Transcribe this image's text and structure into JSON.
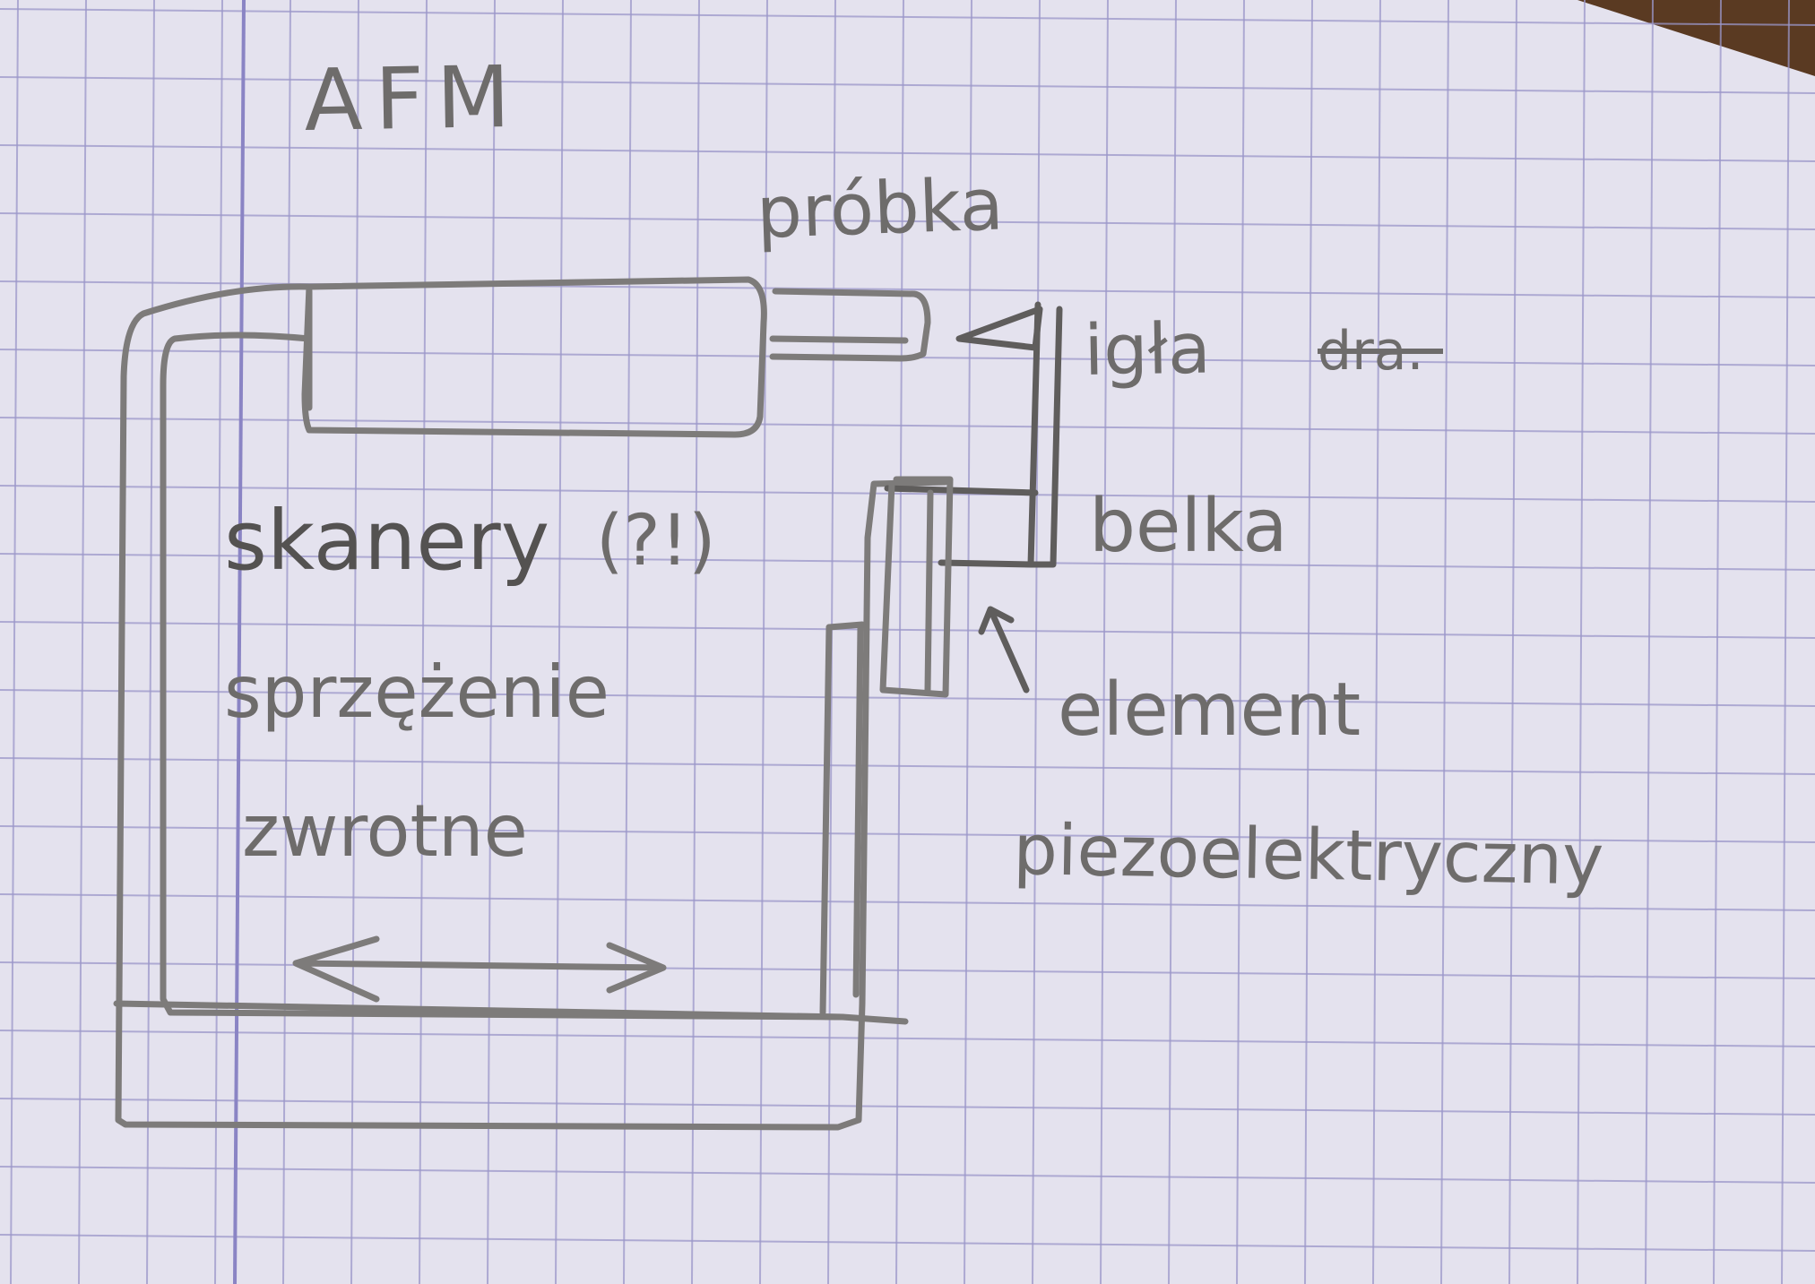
{
  "labels": {
    "title": "AFM",
    "probe": "próbka",
    "tip": "igła",
    "tip_strike": "dra.",
    "beam": "belka",
    "element_line1": "element",
    "element_line2": "piezoelektryczny",
    "scanners": "skanery",
    "scanners_question": "(?!)",
    "feedback_line1": "sprzężenie",
    "feedback_line2": "zwrotne"
  },
  "colors": {
    "paper": "#e4e2ee",
    "grid": "#9b97c9",
    "margin_line": "#8a84c4",
    "pencil": "#7d7b7a",
    "table": "#5a3a22"
  },
  "icons": {
    "tip": "triangle-tip-icon",
    "arrow_up": "arrow-up-icon",
    "arrow_double": "double-arrow-icon"
  }
}
